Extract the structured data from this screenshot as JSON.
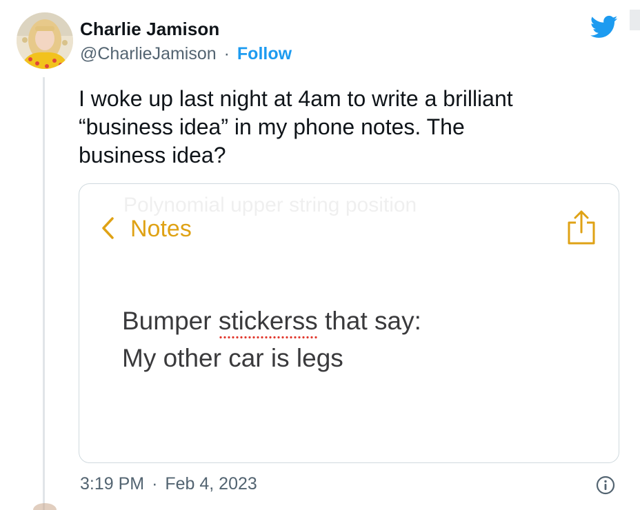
{
  "author": {
    "name": "Charlie Jamison",
    "handle": "@CharlieJamison",
    "separator": "·",
    "follow_label": "Follow"
  },
  "tweet": {
    "text": "I woke up last night at 4am to write a brilliant\n“business idea” in my phone notes. The\nbusiness idea?"
  },
  "note_card": {
    "ghost_text": "Polynomial upper string position",
    "back_label": "Notes",
    "line1_start": "Bumper ",
    "line1_misspelled": "stickerss",
    "line1_end": " that say:",
    "line2": "My other car is legs"
  },
  "meta": {
    "time": "3:19 PM",
    "separator": "·",
    "date": "Feb 4, 2023"
  },
  "icons": {
    "platform": "bird-icon",
    "back": "chevron-left-icon",
    "share": "share-icon",
    "info": "info-icon"
  },
  "colors": {
    "twitter_blue": "#1d9bf0",
    "notes_gold": "#dfa215",
    "text_primary": "#0f1419",
    "text_secondary": "#536471"
  }
}
